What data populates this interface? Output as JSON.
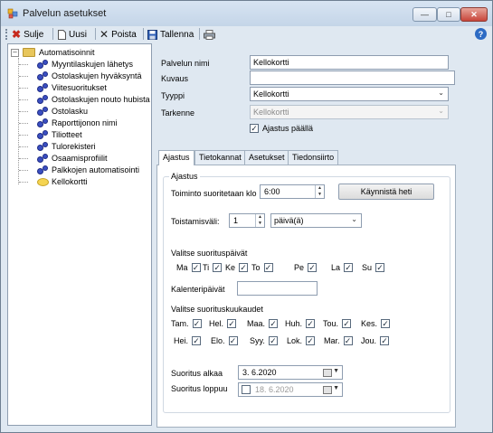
{
  "window": {
    "title": "Palvelun asetukset"
  },
  "toolbar": {
    "close_label": "Sulje",
    "new_label": "Uusi",
    "delete_label": "Poista",
    "save_label": "Tallenna"
  },
  "tree": {
    "root": "Automatisoinnit",
    "items": [
      "Myyntilaskujen lähetys",
      "Ostolaskujen hyväksyntä",
      "Viitesuoritukset",
      "Ostolaskujen nouto hubista",
      "Ostolasku",
      "Raporttijonon nimi",
      "Tiliotteet",
      "Tulorekisteri",
      "Osaamisprofiilit",
      "Palkkojen automatisointi",
      "Kellokortti"
    ]
  },
  "form": {
    "name_label": "Palvelun nimi",
    "name_value": "Kellokortti",
    "desc_label": "Kuvaus",
    "desc_value": "",
    "type_label": "Tyyppi",
    "type_value": "Kellokortti",
    "detail_label": "Tarkenne",
    "detail_value": "Kellokortti",
    "schedule_on_label": "Ajastus päällä",
    "schedule_on_checked": true
  },
  "tabs": [
    "Ajastus",
    "Tietokannat",
    "Asetukset",
    "Tiedonsiirto"
  ],
  "schedule": {
    "group_title": "Ajastus",
    "run_at_label": "Toiminto suoritetaan klo",
    "run_at_value": "6:00",
    "run_now_label": "Käynnistä heti",
    "repeat_label": "Toistamisväli:",
    "repeat_value": "1",
    "repeat_unit": "päivä(ä)",
    "days_title": "Valitse suorituspäivät",
    "days": [
      {
        "label": "Ma",
        "checked": true
      },
      {
        "label": "Ti",
        "checked": true
      },
      {
        "label": "Ke",
        "checked": true
      },
      {
        "label": "To",
        "checked": true
      },
      {
        "label": "Pe",
        "checked": true
      },
      {
        "label": "La",
        "checked": true
      },
      {
        "label": "Su",
        "checked": true
      }
    ],
    "calendar_days_label": "Kalenteripäivät",
    "calendar_days_value": "",
    "months_title": "Valitse suorituskuukaudet",
    "months": [
      {
        "label": "Tam.",
        "checked": true
      },
      {
        "label": "Hel.",
        "checked": true
      },
      {
        "label": "Maa.",
        "checked": true
      },
      {
        "label": "Huh.",
        "checked": true
      },
      {
        "label": "Tou.",
        "checked": true
      },
      {
        "label": "Kes.",
        "checked": true
      },
      {
        "label": "Hei.",
        "checked": true
      },
      {
        "label": "Elo.",
        "checked": true
      },
      {
        "label": "Syy.",
        "checked": true
      },
      {
        "label": "Lok.",
        "checked": true
      },
      {
        "label": "Mar.",
        "checked": true
      },
      {
        "label": "Jou.",
        "checked": true
      }
    ],
    "start_label": "Suoritus alkaa",
    "start_value": "3. 6.2020",
    "end_label": "Suoritus loppuu",
    "end_value": "18. 6.2020",
    "end_enabled": false
  },
  "colors": {
    "window_bg": "#dfe8f1",
    "checkmark": "#1c2a3a",
    "close_button": "#c8453a"
  }
}
